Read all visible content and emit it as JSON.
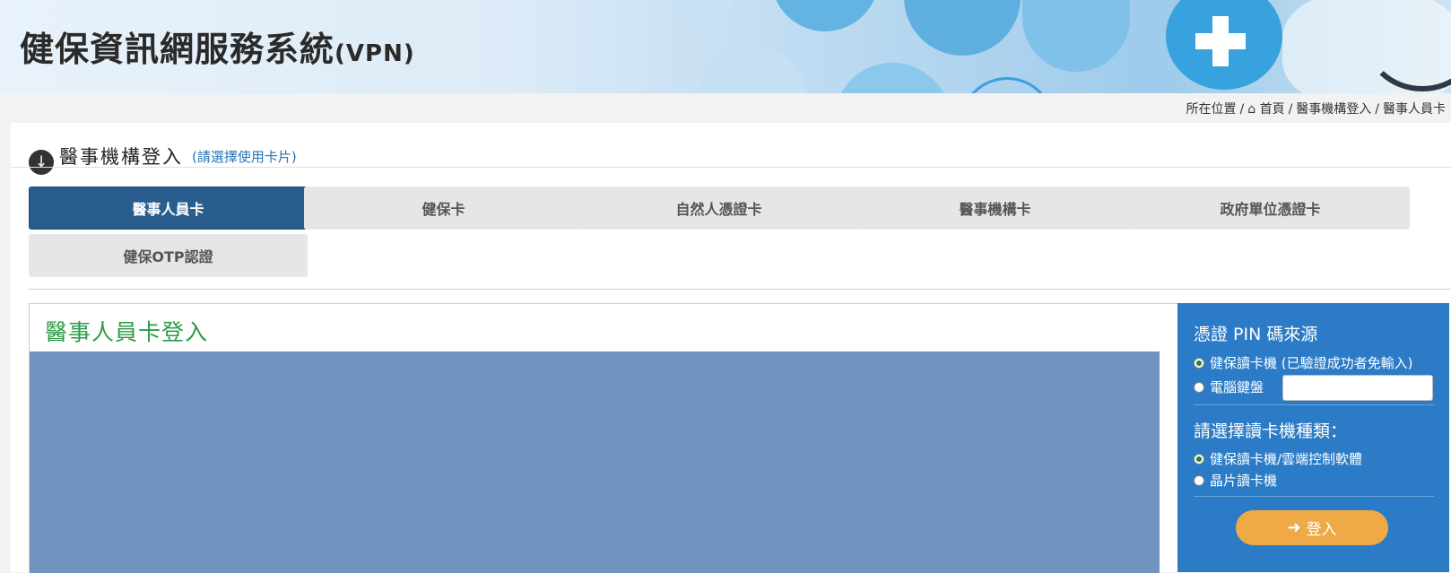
{
  "header": {
    "title": "健保資訊網服務系統",
    "title_suffix": "(VPN)"
  },
  "breadcrumb": {
    "prefix": "所在位置",
    "home_icon": "home-icon",
    "items": [
      "首頁",
      "醫事機構登入",
      "醫事人員卡"
    ]
  },
  "section": {
    "title": "醫事機構登入",
    "subtitle": "(請選擇使用卡片)",
    "icon": "arrow-down-circle-icon"
  },
  "tabs": [
    {
      "label": "醫事人員卡",
      "active": true
    },
    {
      "label": "健保卡",
      "active": false
    },
    {
      "label": "自然人憑證卡",
      "active": false
    },
    {
      "label": "醫事機構卡",
      "active": false
    },
    {
      "label": "政府單位憑證卡",
      "active": false
    },
    {
      "label": "健保OTP認證",
      "active": false
    }
  ],
  "login": {
    "title": "醫事人員卡登入"
  },
  "side": {
    "pin_heading": "憑證 PIN 碼來源",
    "pin_options": [
      {
        "label": "健保讀卡機 (已驗證成功者免輸入)",
        "selected": true
      },
      {
        "label": "電腦鍵盤",
        "selected": false
      }
    ],
    "pin_input_value": "",
    "reader_heading": "請選擇讀卡機種類：",
    "reader_options": [
      {
        "label": "健保讀卡機/雲端控制軟體",
        "selected": true
      },
      {
        "label": "晶片讀卡機",
        "selected": false
      }
    ],
    "login_button": "登入",
    "login_icon": "sign-in-icon"
  },
  "colors": {
    "tab_active": "#295d8e",
    "side_panel": "#2b7bc6",
    "login_button": "#efaa47",
    "login_title": "#2e9a48"
  }
}
